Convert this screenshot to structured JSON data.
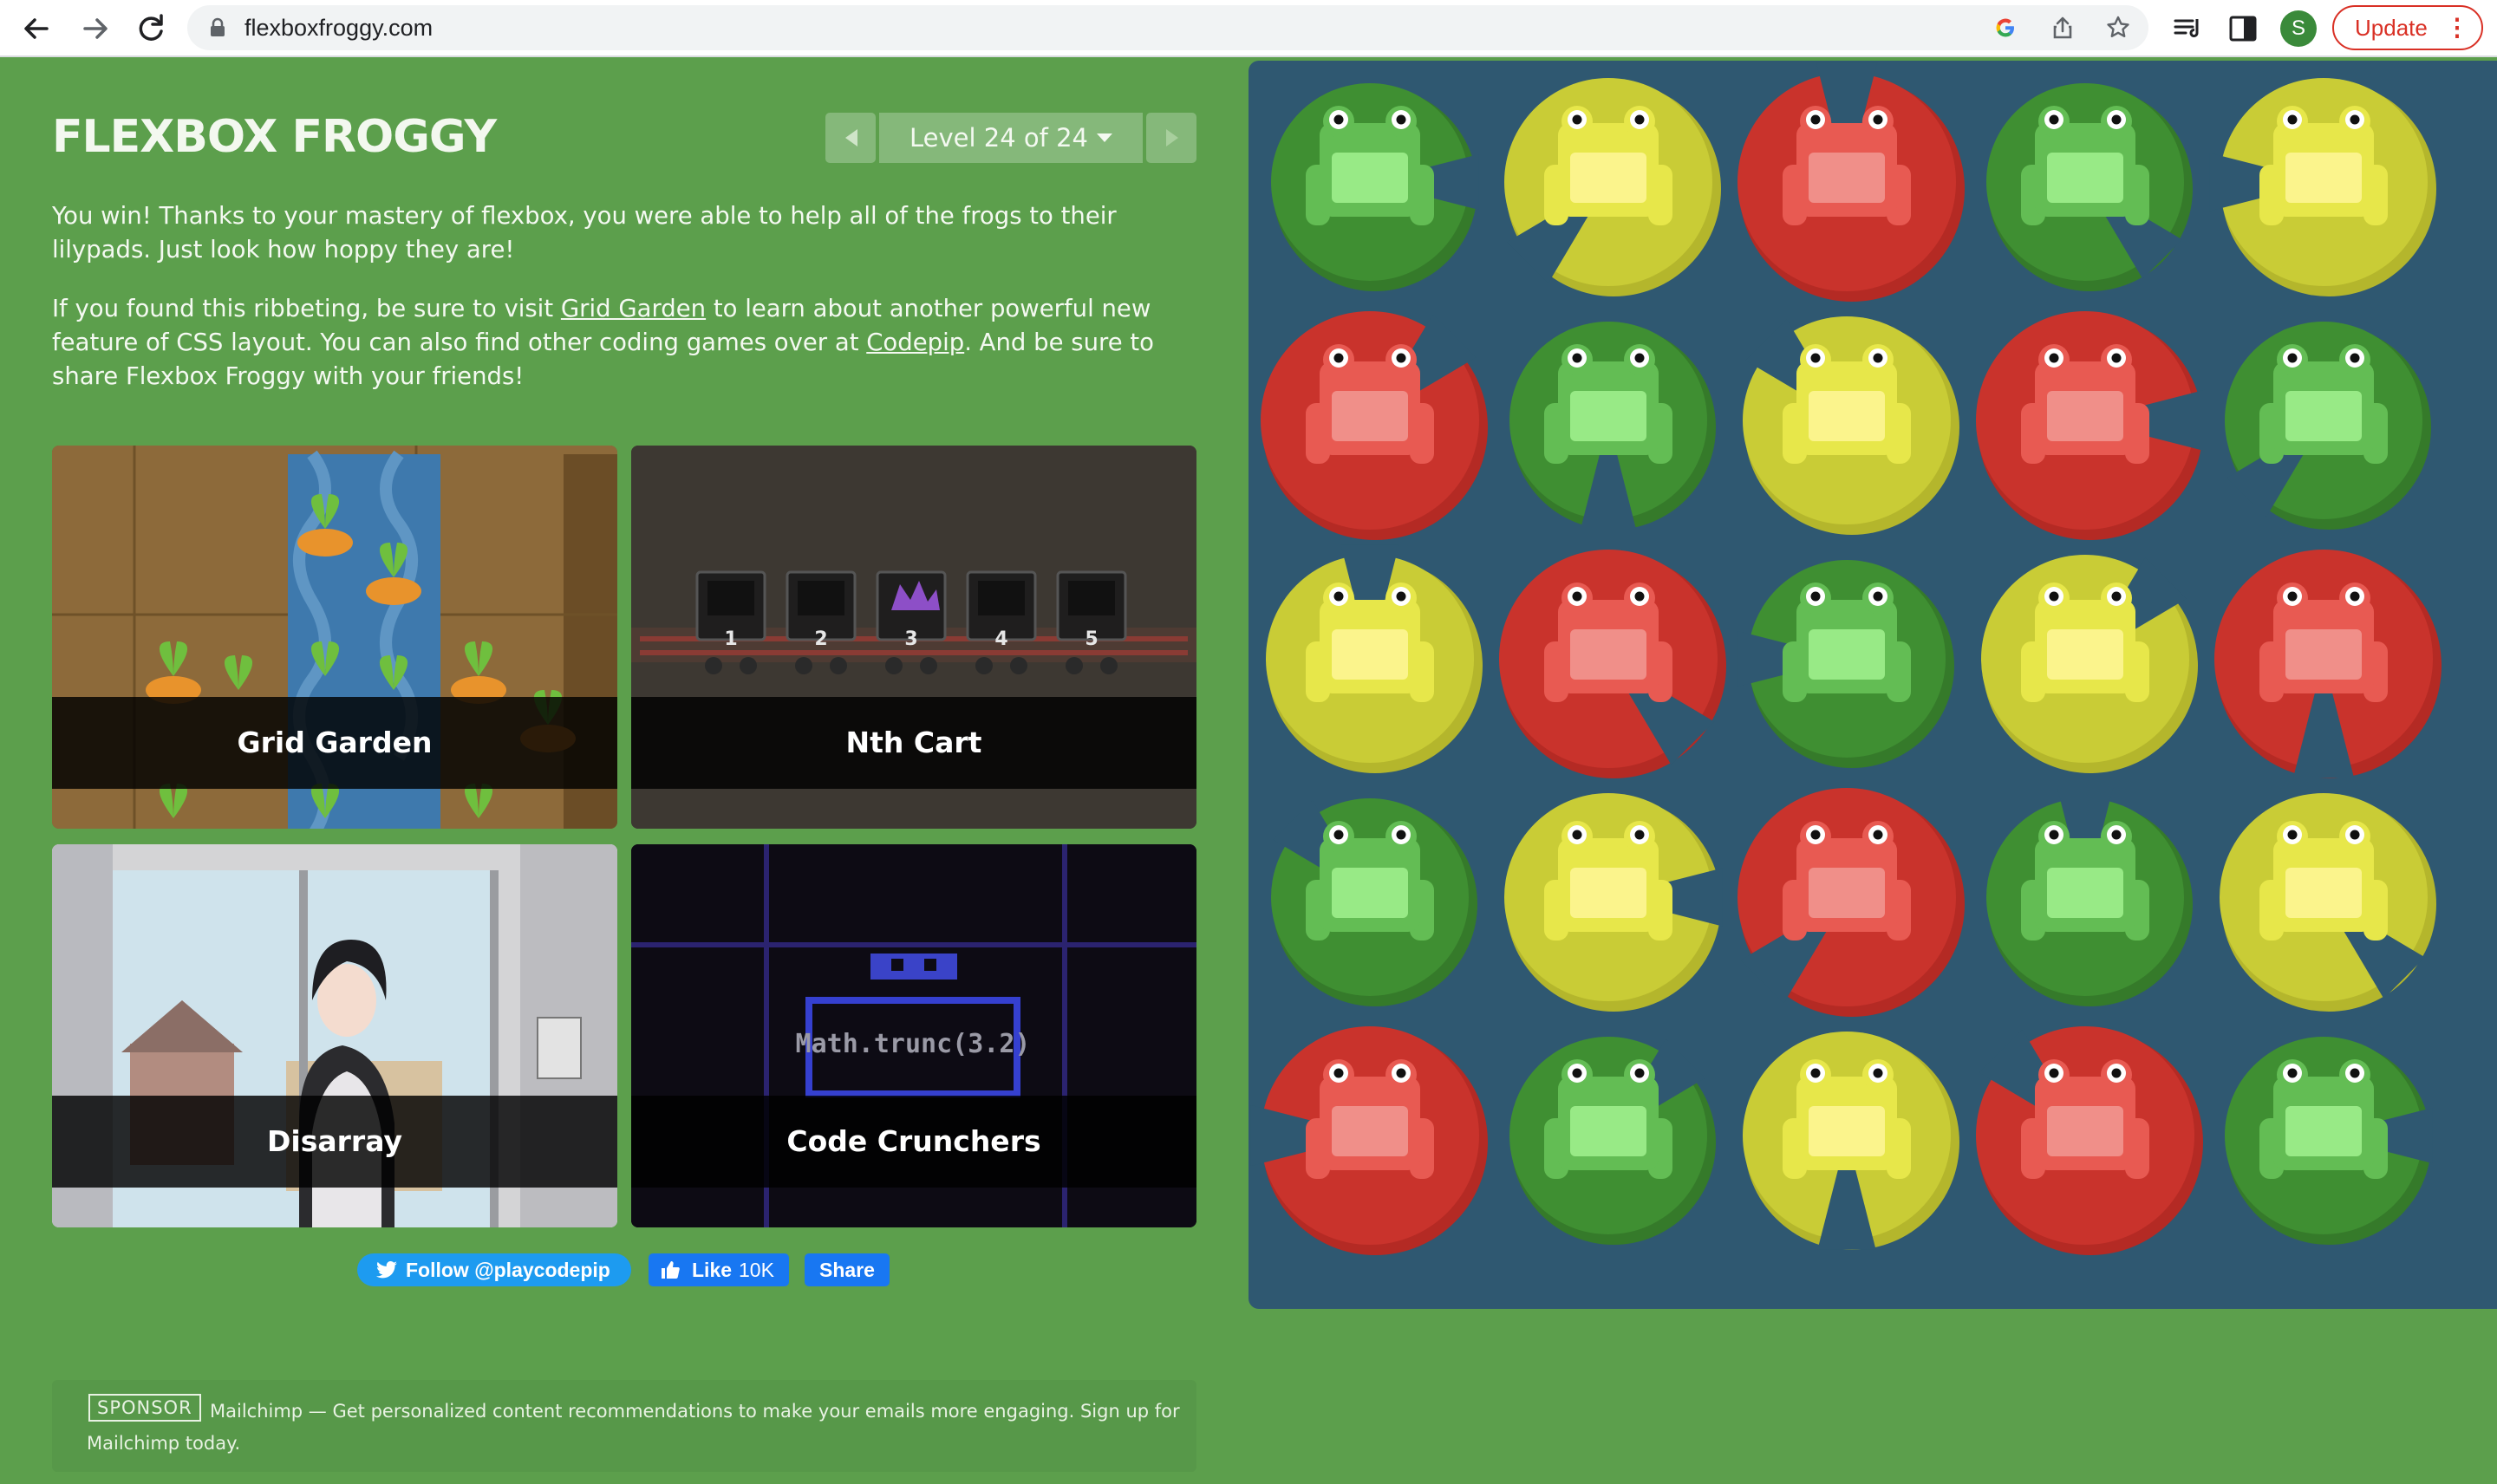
{
  "browser": {
    "url": "flexboxfroggy.com",
    "avatar_letter": "S",
    "update_label": "Update",
    "update_menu": "⋮"
  },
  "game": {
    "title": "FLEXBOX FROGGY",
    "level_label": "Level 24 of 24",
    "win_text": "You win! Thanks to your mastery of flexbox, you were able to help all of the frogs to their lilypads. Just look how hoppy they are!",
    "para2_prefix": "If you found this ribbeting, be sure to visit ",
    "grid_garden_link": "Grid Garden",
    "para2_middle": " to learn about another powerful new feature of CSS layout. You can also find other coding games over at ",
    "codepip_link": "Codepip",
    "para2_suffix": ". And be sure to share Flexbox Froggy with your friends!"
  },
  "games": [
    {
      "name": "Grid Garden"
    },
    {
      "name": "Nth Cart",
      "cart_numbers": [
        "1",
        "2",
        "3",
        "4",
        "5"
      ]
    },
    {
      "name": "Disarray"
    },
    {
      "name": "Code Crunchers",
      "code_text": "Math.trunc(3.2)"
    }
  ],
  "social": {
    "twitter_label": "Follow @playcodepip",
    "like_label": "Like",
    "like_count": "10K",
    "share_label": "Share"
  },
  "sponsor": {
    "tag": "SPONSOR",
    "text": "Mailchimp — Get personalized content recommendations to make your emails more engaging. Sign up for Mailchimp today."
  },
  "pond": {
    "colors": {
      "green": "#3f8f32",
      "yellow": "#c9cc36",
      "red": "#c9332c"
    },
    "rows": [
      [
        "green",
        "yellow",
        "red",
        "green",
        "yellow"
      ],
      [
        "red",
        "green",
        "yellow",
        "red",
        "green"
      ],
      [
        "yellow",
        "red",
        "green",
        "yellow",
        "red"
      ],
      [
        "green",
        "yellow",
        "red",
        "green",
        "yellow"
      ],
      [
        "red",
        "green",
        "yellow",
        "red",
        "green"
      ]
    ]
  }
}
